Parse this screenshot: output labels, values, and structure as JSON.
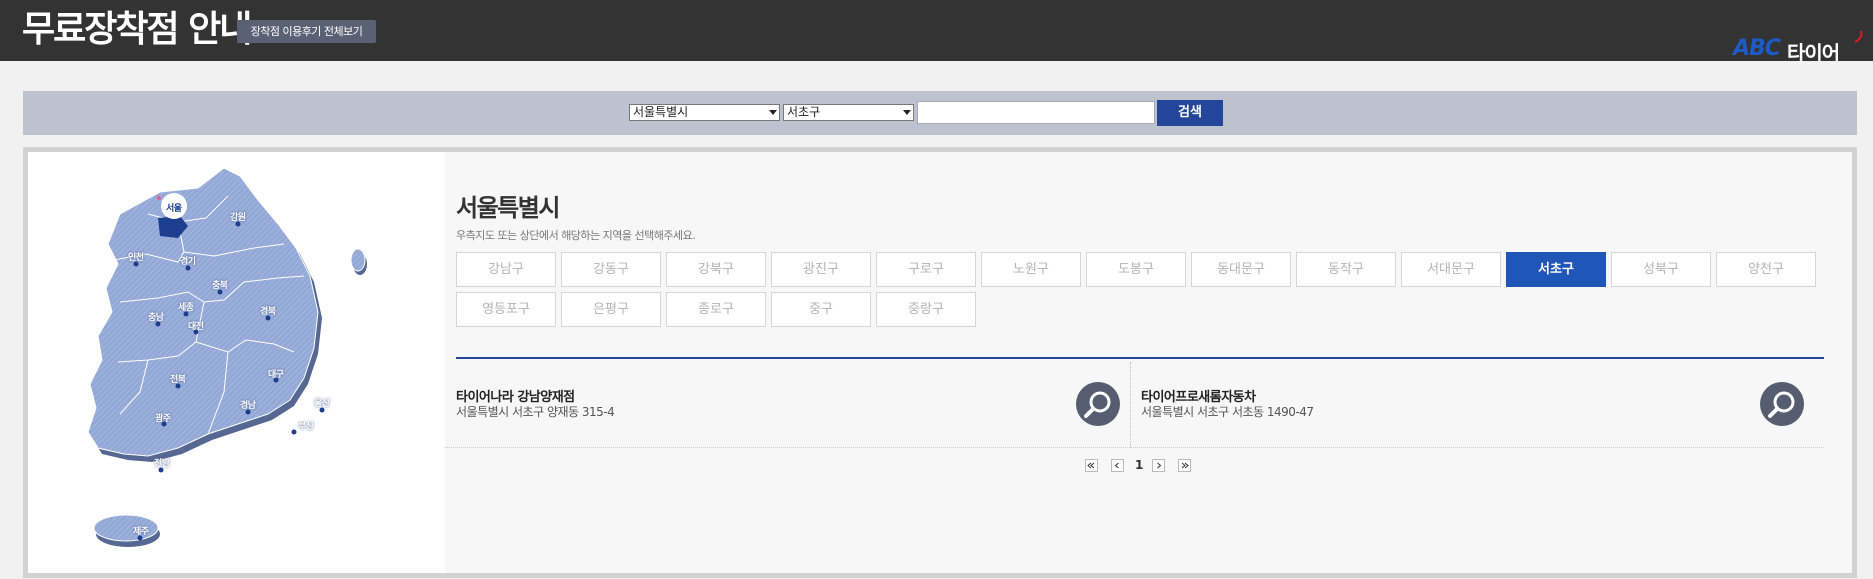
{
  "header": {
    "title": "무료장착점 안내",
    "review_button": "장착점 이용후기 전체보기",
    "logo_abc": "ABC",
    "logo_kr": "타이어"
  },
  "search": {
    "city": "서울특별시",
    "district": "서초구",
    "keyword": "",
    "button": "검색"
  },
  "map": {
    "labels": [
      "서울",
      "강원",
      "인천",
      "경기",
      "충북",
      "세종",
      "충남",
      "대전",
      "경북",
      "대구",
      "전북",
      "경남",
      "울산",
      "광주",
      "부산",
      "전남",
      "제주"
    ],
    "selected": "서울"
  },
  "region": {
    "title": "서울특별시",
    "guide": "우측지도 또는 상단에서 해당하는 지역을 선택해주세요.",
    "districts": [
      "강남구",
      "강동구",
      "강북구",
      "광진구",
      "구로구",
      "노원구",
      "도봉구",
      "동대문구",
      "동작구",
      "서대문구",
      "서초구",
      "성북구",
      "양천구",
      "영등포구",
      "은평구",
      "종로구",
      "중구",
      "중랑구"
    ],
    "active": "서초구"
  },
  "stores": [
    {
      "name": "타이어나라 강남양재점",
      "address": "서울특별시 서초구 양재동 315-4"
    },
    {
      "name": "타이어프로새롬자동차",
      "address": "서울특별시 서초구 서초동 1490-47"
    }
  ],
  "pagination": {
    "current": "1"
  },
  "colors": {
    "header": "#333333",
    "accent": "#2156b9",
    "search_bar": "#bcc2ce",
    "map": "#8fa5d6"
  }
}
